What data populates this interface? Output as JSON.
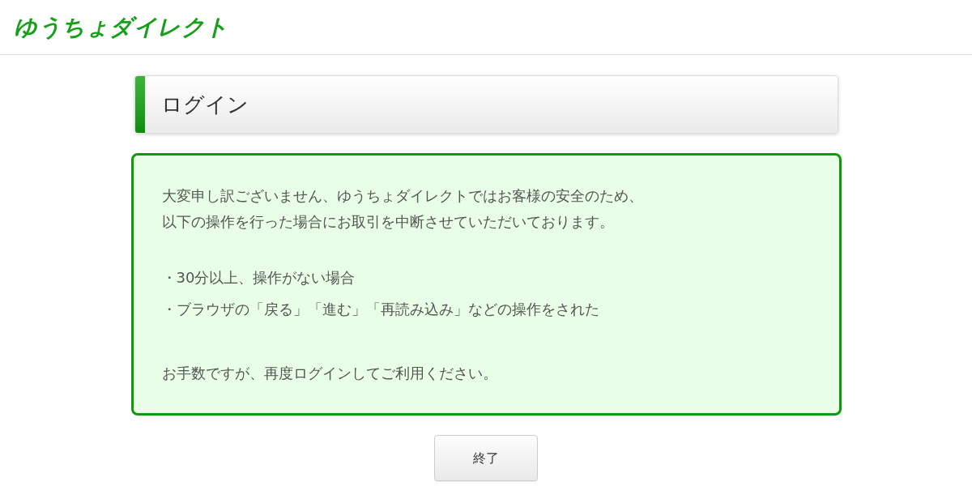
{
  "header": {
    "logo": "ゆうちょダイレクト"
  },
  "page_title": "ログイン",
  "notice": {
    "intro": [
      "大変申し訳ございません、ゆうちょダイレクトではお客様の安全のため、",
      "以下の操作を行った場合にお取引を中断させていただいております。"
    ],
    "conditions": [
      "・30分以上、操作がない場合",
      "・ブラウザの「戻る」「進む」「再読み込み」などの操作をされた"
    ],
    "closing": "お手数ですが、再度ログインしてご利用ください。"
  },
  "buttons": [
    {
      "label": "終了"
    }
  ]
}
